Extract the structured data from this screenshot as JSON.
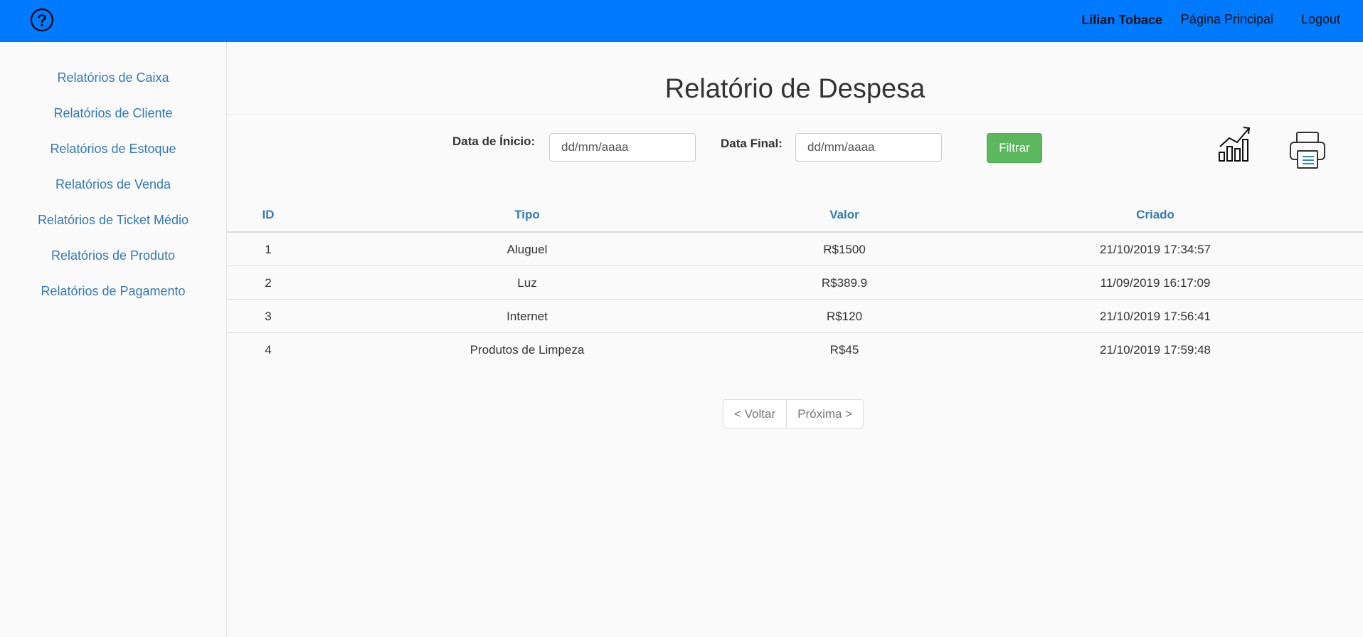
{
  "topbar": {
    "help_icon": "help-circle-icon",
    "user_name": "Lilian Tobace",
    "home_label": "Página Principal",
    "logout_label": "Logout",
    "color": "#007bff"
  },
  "sidebar": {
    "items": [
      {
        "label": "Relatórios de Caixa"
      },
      {
        "label": "Relatórios de Cliente"
      },
      {
        "label": "Relatórios de Estoque"
      },
      {
        "label": "Relatórios de Venda"
      },
      {
        "label": "Relatórios de Ticket Médio"
      },
      {
        "label": "Relatórios de Produto"
      },
      {
        "label": "Relatórios de Pagamento"
      }
    ]
  },
  "main": {
    "title": "Relatório de Despesa",
    "filter": {
      "start_label": "Data de Ínicio:",
      "start_placeholder": "dd/mm/aaaa",
      "start_value": "",
      "end_label": "Data Final:",
      "end_placeholder": "dd/mm/aaaa",
      "end_value": "",
      "button_label": "Filtrar",
      "button_color": "#5cb85c"
    },
    "icons": {
      "chart": "chart-growth-icon",
      "print": "printer-icon"
    },
    "table": {
      "headers": [
        "ID",
        "Tipo",
        "Valor",
        "Criado"
      ],
      "rows": [
        [
          "1",
          "Aluguel",
          "R$1500",
          "21/10/2019 17:34:57"
        ],
        [
          "2",
          "Luz",
          "R$389.9",
          "11/09/2019 16:17:09"
        ],
        [
          "3",
          "Internet",
          "R$120",
          "21/10/2019 17:56:41"
        ],
        [
          "4",
          "Produtos de Limpeza",
          "R$45",
          "21/10/2019 17:59:48"
        ]
      ]
    },
    "pager": {
      "prev_label": "< Voltar",
      "next_label": "Próxima >"
    }
  }
}
